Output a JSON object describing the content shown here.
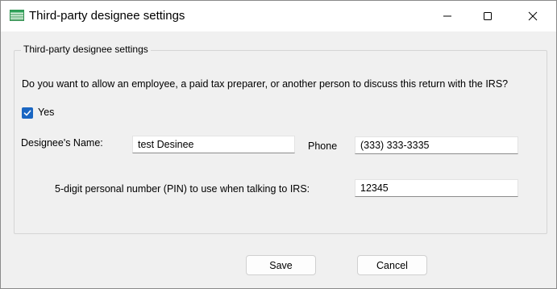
{
  "window": {
    "title": "Third-party designee settings",
    "icon": "green-table-app-icon"
  },
  "titlebar_controls": {
    "minimize": "minimize-icon",
    "maximize": "maximize-icon",
    "close": "close-icon"
  },
  "group": {
    "legend": "Third-party designee settings"
  },
  "question": "Do you want to allow an employee, a paid tax preparer, or  another person to discuss this return with the IRS?",
  "allow_checkbox": {
    "label": "Yes",
    "checked": true
  },
  "fields": {
    "designee_name_label": "Designee's Name:",
    "designee_name_value": "test Desinee",
    "phone_label": "Phone",
    "phone_value": "(333) 333-3335",
    "pin_label": "5-digit personal number (PIN) to use when talking to IRS:",
    "pin_value": "12345"
  },
  "buttons": {
    "save": "Save",
    "cancel": "Cancel"
  },
  "colors": {
    "accent": "#1a66c2",
    "dialog_background": "#f0f0f0",
    "titlebar_background": "#ffffff"
  }
}
